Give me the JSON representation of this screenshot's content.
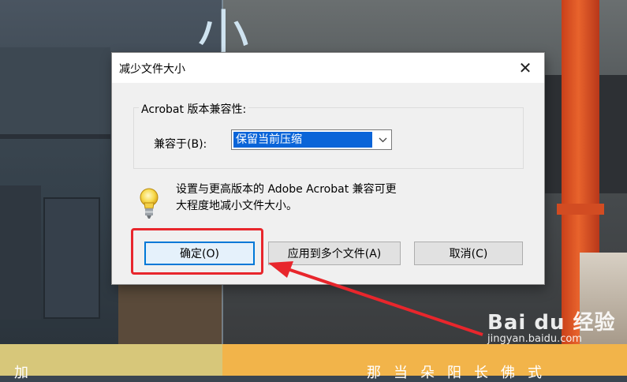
{
  "dialog": {
    "title": "减少文件大小",
    "close_glyph": "✕",
    "group_label": "Acrobat 版本兼容性:",
    "compat_label": "兼容于(B):",
    "compat_selected": "保留当前压缩",
    "message_line1": "设置与更高版本的 Adobe Acrobat 兼容可更",
    "message_line2": "大程度地减小文件大小。",
    "buttons": {
      "ok": "确定(O)",
      "apply_multiple": "应用到多个文件(A)",
      "cancel": "取消(C)"
    }
  },
  "background": {
    "big_char": "小",
    "bottom_left_char": "加",
    "bottom_right_text": "那当朵阳长佛式"
  },
  "watermark": {
    "brand": "Bai du 经验",
    "url": "jingyan.baidu.com"
  },
  "annotation": {
    "color": "#e8262c"
  },
  "icons": {
    "close": "close-icon",
    "dropdown": "chevron-down-icon",
    "hint": "lightbulb-icon"
  }
}
